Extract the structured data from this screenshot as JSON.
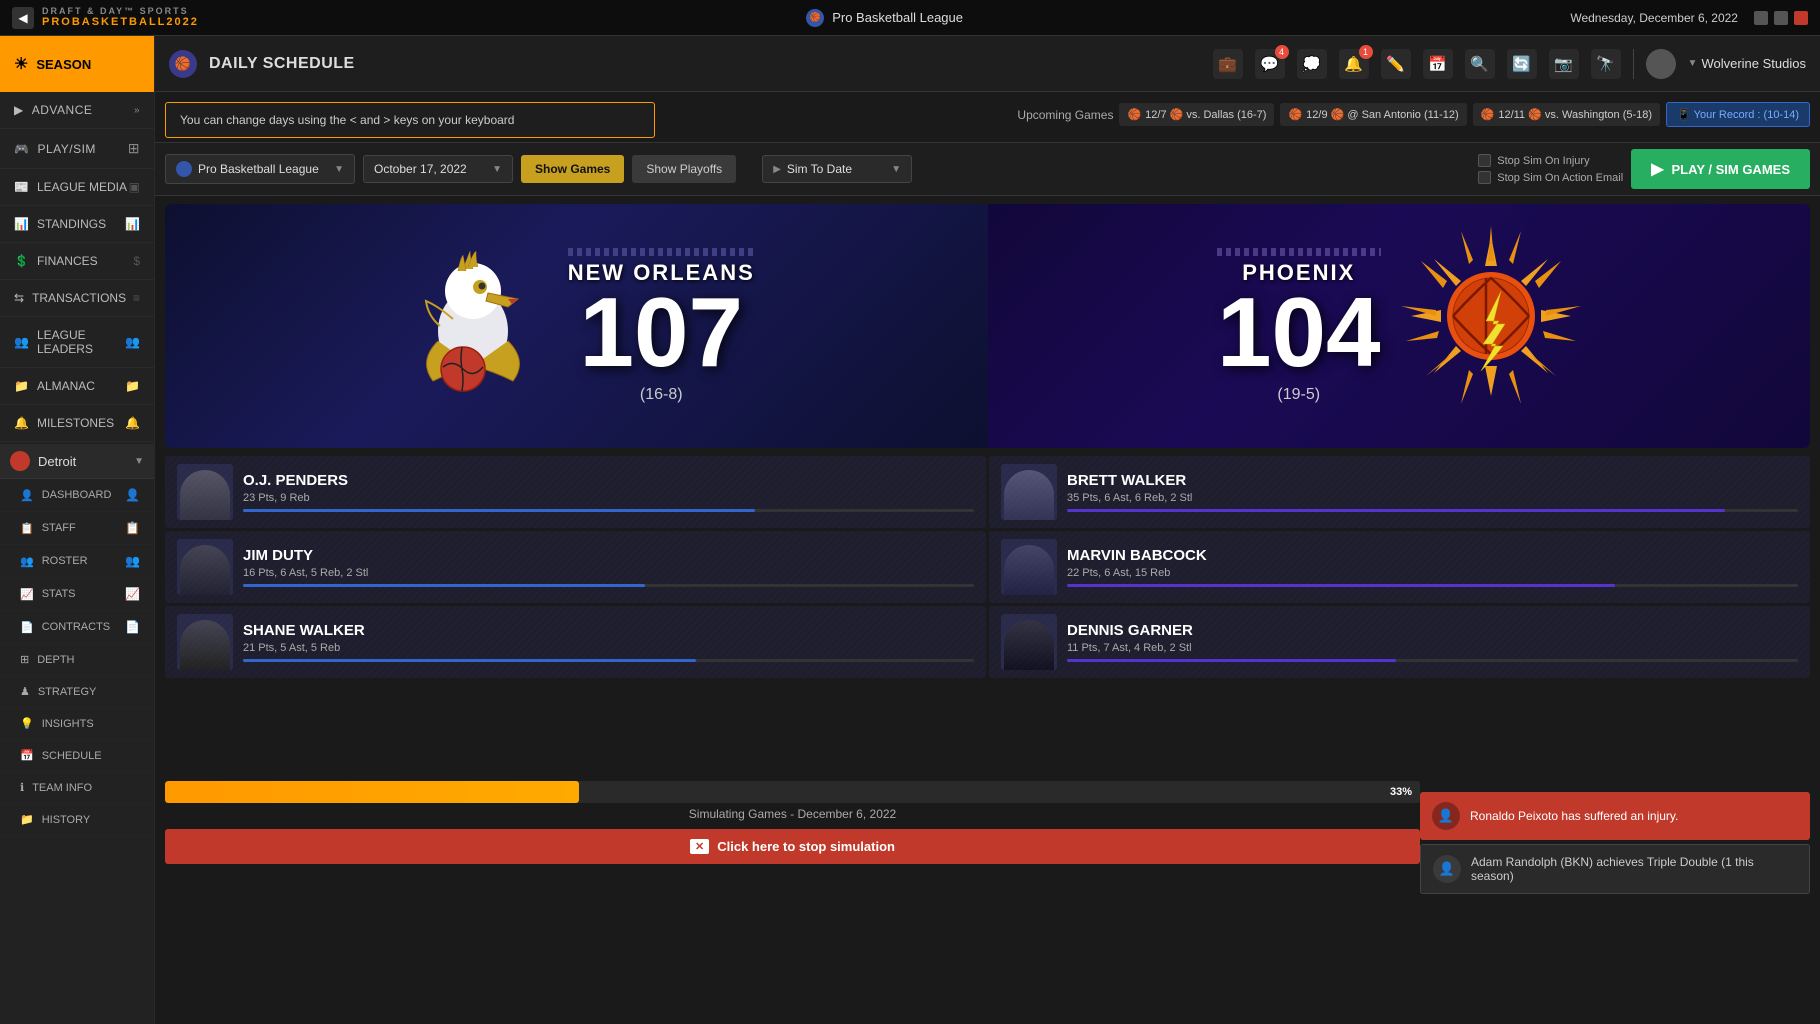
{
  "topbar": {
    "logo": "PROBASKETBALL2022",
    "title": "Pro Basketball League",
    "date": "Wednesday, December 6, 2022",
    "user": "Wolverine Studios"
  },
  "header": {
    "season_label": "SEASON",
    "daily_schedule_label": "DAILY SCHEDULE"
  },
  "sidebar": {
    "top_items": [
      {
        "label": "ADVANCE",
        "icon": "▶▶",
        "arrow": "»"
      },
      {
        "label": "PLAY/SIM",
        "icon": "🎮",
        "arrow": ""
      }
    ],
    "menu_items": [
      {
        "label": "LEAGUE MEDIA",
        "icon": "📰"
      },
      {
        "label": "STANDINGS",
        "icon": "📊"
      },
      {
        "label": "FINANCES",
        "icon": "💲"
      },
      {
        "label": "TRANSACTIONS",
        "icon": "⇆"
      },
      {
        "label": "LEAGUE LEADERS",
        "icon": "👥"
      },
      {
        "label": "ALMANAC",
        "icon": "📁"
      },
      {
        "label": "MILESTONES",
        "icon": "🔔"
      }
    ],
    "team": "Detroit",
    "team_menu": [
      {
        "label": "DASHBOARD",
        "icon": "👤"
      },
      {
        "label": "STAFF",
        "icon": "📋"
      },
      {
        "label": "ROSTER",
        "icon": "👥"
      },
      {
        "label": "STATS",
        "icon": "📈"
      },
      {
        "label": "CONTRACTS",
        "icon": "📄"
      },
      {
        "label": "DEPTH",
        "icon": "⊞"
      },
      {
        "label": "STRATEGY",
        "icon": "♟"
      },
      {
        "label": "INSIGHTS",
        "icon": "💡"
      },
      {
        "label": "SCHEDULE",
        "icon": "📅"
      },
      {
        "label": "TEAM INFO",
        "icon": "ℹ"
      },
      {
        "label": "HISTORY",
        "icon": "📁"
      }
    ]
  },
  "notification": {
    "text": "You can change days using the < and > keys on your keyboard"
  },
  "upcoming": {
    "label": "Upcoming Games",
    "games": [
      {
        "text": "12/7 🏀 vs. Dallas (16-7)"
      },
      {
        "text": "12/9 🏀 @ San Antonio (11-12)"
      },
      {
        "text": "12/11 🏀 vs. Washington (5-18)"
      }
    ],
    "record": "Your Record : (10-14)"
  },
  "controls": {
    "league": "Pro Basketball League",
    "date": "October 17, 2022",
    "show_games": "Show Games",
    "show_playoffs": "Show Playoffs",
    "sim_to_date": "Sim To Date",
    "stop_sim_injury": "Stop Sim On Injury",
    "stop_sim_action": "Stop Sim On Action Email",
    "play_sim": "PLAY / SIM GAMES"
  },
  "scoreboard": {
    "home": {
      "city": "NEW ORLEANS",
      "score": "107",
      "record": "(16-8)"
    },
    "away": {
      "city": "PHOENIX",
      "score": "104",
      "record": "(19-5)"
    }
  },
  "players": {
    "home": [
      {
        "name": "O.J. PENDERS",
        "stats": "23 Pts, 9 Reb",
        "bar": 70
      },
      {
        "name": "JIM DUTY",
        "stats": "16 Pts, 6 Ast, 5 Reb, 2 Stl",
        "bar": 55
      },
      {
        "name": "SHANE WALKER",
        "stats": "21 Pts, 5 Ast, 5 Reb",
        "bar": 62
      }
    ],
    "away": [
      {
        "name": "BRETT WALKER",
        "stats": "35 Pts, 6 Ast, 6 Reb, 2 Stl",
        "bar": 90
      },
      {
        "name": "MARVIN BABCOCK",
        "stats": "22 Pts, 6 Ast, 15 Reb",
        "bar": 75
      },
      {
        "name": "DENNIS GARNER",
        "stats": "11 Pts, 7 Ast, 4 Reb, 2 Stl",
        "bar": 45
      }
    ]
  },
  "simulation": {
    "progress": 33,
    "progress_label": "33%",
    "status": "Simulating Games - December 6, 2022",
    "stop_button": "Click here to stop simulation"
  },
  "notifications_panel": [
    {
      "type": "red",
      "text": "Ronaldo Peixoto has suffered an injury."
    },
    {
      "type": "dark",
      "text": "Adam Randolph (BKN) achieves Triple Double (1 this season)"
    }
  ],
  "header_icons": [
    {
      "name": "briefcase-icon",
      "symbol": "💼",
      "badge": null
    },
    {
      "name": "chat-icon",
      "symbol": "💬",
      "badge": "4"
    },
    {
      "name": "speech-icon",
      "symbol": "💭",
      "badge": null
    },
    {
      "name": "bell-icon",
      "symbol": "🔔",
      "badge": "1"
    },
    {
      "name": "edit-icon",
      "symbol": "✏️",
      "badge": null
    },
    {
      "name": "calendar-icon",
      "symbol": "📅",
      "badge": null
    },
    {
      "name": "search-icon",
      "symbol": "🔍",
      "badge": null
    },
    {
      "name": "refresh-icon",
      "symbol": "🔄",
      "badge": null
    },
    {
      "name": "camera-icon",
      "symbol": "📷",
      "badge": null
    },
    {
      "name": "binoculars-icon",
      "symbol": "🔭",
      "badge": null
    }
  ]
}
